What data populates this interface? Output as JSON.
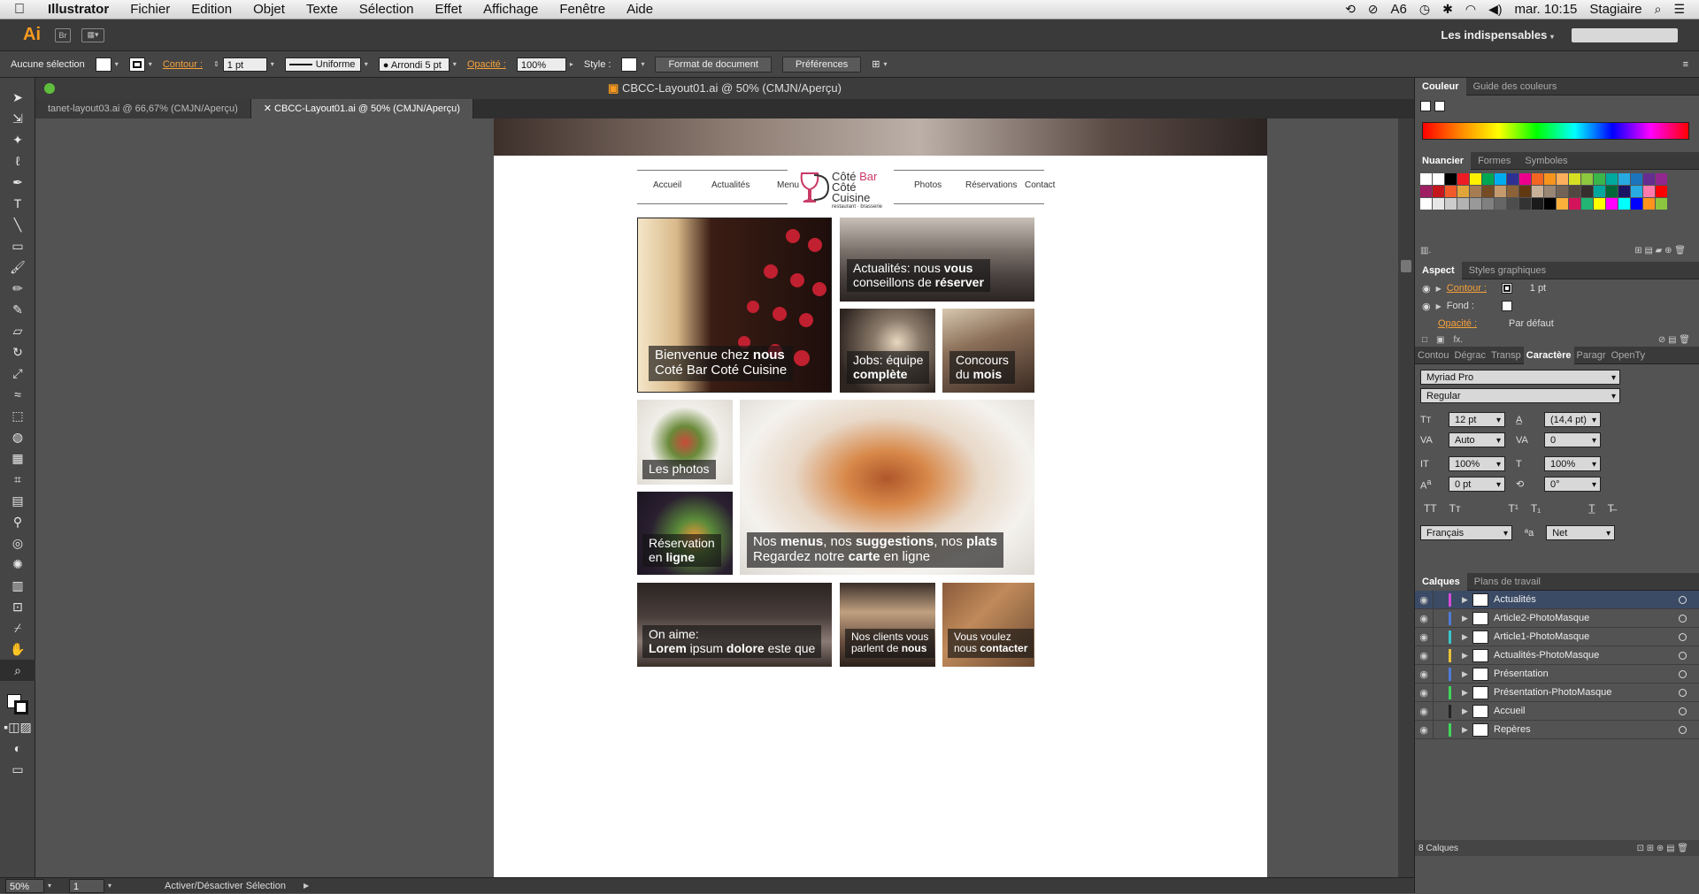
{
  "menubar": {
    "app": "Illustrator",
    "items": [
      "Fichier",
      "Edition",
      "Objet",
      "Texte",
      "Sélection",
      "Effet",
      "Affichage",
      "Fenêtre",
      "Aide"
    ],
    "battery_label": "6",
    "clock": "mar. 10:15",
    "user": "Stagiaire"
  },
  "appbar": {
    "logo": "Ai",
    "bridge": "Br",
    "workspace": "Les indispensables"
  },
  "control": {
    "selection_label": "Aucune sélection",
    "stroke_label": "Contour :",
    "stroke_value": "1 pt",
    "stroke_style": "Uniforme",
    "brush": "Arrondi 5 pt",
    "opacity_label": "Opacité :",
    "opacity_value": "100%",
    "style_label": "Style :",
    "doc_format_button": "Format de document",
    "prefs_button": "Préférences"
  },
  "document": {
    "window_title": "CBCC-Layout01.ai @ 50% (CMJN/Aperçu)",
    "tabs": [
      {
        "label": "tanet-layout03.ai @ 66,67% (CMJN/Aperçu)",
        "active": false
      },
      {
        "label": "CBCC-Layout01.ai @ 50% (CMJN/Aperçu)",
        "active": true
      }
    ]
  },
  "site": {
    "nav_left": [
      "Accueil",
      "Actualités",
      "Menu"
    ],
    "nav_right": [
      "Photos",
      "Réservations",
      "Contact"
    ],
    "logo_line1a": "Côté ",
    "logo_line1b": "Bar",
    "logo_line2": "Côté Cuisine",
    "logo_line3": "restaurant · brasserie",
    "tiles": {
      "bienvenue": {
        "pre": "Bienvenue chez ",
        "bold": "nous",
        "line2": "Coté Bar Coté Cuisine"
      },
      "actualites": {
        "pre": "Actualités: nous ",
        "bold": "vous",
        "line2pre": "conseillons de ",
        "line2bold": "réserver"
      },
      "jobs": {
        "line1": "Jobs: équipe",
        "bold": "complète"
      },
      "concours": {
        "line1": "Concours",
        "pre2": "du ",
        "bold": "mois"
      },
      "photos": {
        "text": "Les photos"
      },
      "menus": {
        "p1": "Nos ",
        "b1": "menus",
        "p2": ", nos ",
        "b2": "suggestions",
        "p3": ", nos ",
        "b3": "plats",
        "l2a": "Regardez notre ",
        "l2b": "carte",
        "l2c": " en ligne"
      },
      "reservation": {
        "line1": "Réservation",
        "pre2": "en ",
        "bold": "ligne"
      },
      "onaime": {
        "line1": "On aime:",
        "b1": "Lorem",
        "p1": " ipsum ",
        "b2": "dolore",
        "p2": " este que"
      },
      "clients": {
        "line1": "Nos clients vous",
        "pre2": "parlent de ",
        "bold": "nous"
      },
      "contact": {
        "line1": "Vous voulez",
        "pre2": "nous ",
        "bold": "contacter"
      }
    }
  },
  "status": {
    "zoom": "50%",
    "page": "1",
    "message": "Activer/Désactiver Sélection"
  },
  "panels": {
    "color_tabs": [
      "Couleur",
      "Guide des couleurs"
    ],
    "swatch_tabs": [
      "Nuancier",
      "Formes",
      "Symboles"
    ],
    "aspect_tabs": [
      "Aspect",
      "Styles graphiques"
    ],
    "aspect": {
      "contour_label": "Contour :",
      "contour_value": "1 pt",
      "fond_label": "Fond :",
      "opacity_label": "Opacité :",
      "opacity_value": "Par défaut"
    },
    "char_tabs": [
      "Contou",
      "Dégrac",
      "Transp",
      "Caractère",
      "Paragr",
      "OpenTy"
    ],
    "character": {
      "font": "Myriad Pro",
      "style": "Regular",
      "size": "12 pt",
      "leading": "(14,4 pt)",
      "kerning": "Auto",
      "tracking": "0",
      "vscale": "100%",
      "hscale": "100%",
      "baseline": "0 pt",
      "rotation": "0°",
      "language": "Français",
      "aa": "Net",
      "aa_icon": "ªa"
    },
    "layers_tabs": [
      "Calques",
      "Plans de travail"
    ],
    "layers": [
      {
        "name": "Actualités",
        "color": "#d24bd6",
        "selected": true
      },
      {
        "name": "Article2-PhotoMasque",
        "color": "#4f7bd8",
        "selected": false
      },
      {
        "name": "Article1-PhotoMasque",
        "color": "#39c6c9",
        "selected": false
      },
      {
        "name": "Actualités-PhotoMasque",
        "color": "#e6c13a",
        "selected": false
      },
      {
        "name": "Présentation",
        "color": "#4f7bd8",
        "selected": false
      },
      {
        "name": "Présentation-PhotoMasque",
        "color": "#3fd65a",
        "selected": false
      },
      {
        "name": "Accueil",
        "color": "#222222",
        "selected": false
      },
      {
        "name": "Repères",
        "color": "#3fd65a",
        "selected": false
      }
    ],
    "layer_count": "8 Calques"
  }
}
